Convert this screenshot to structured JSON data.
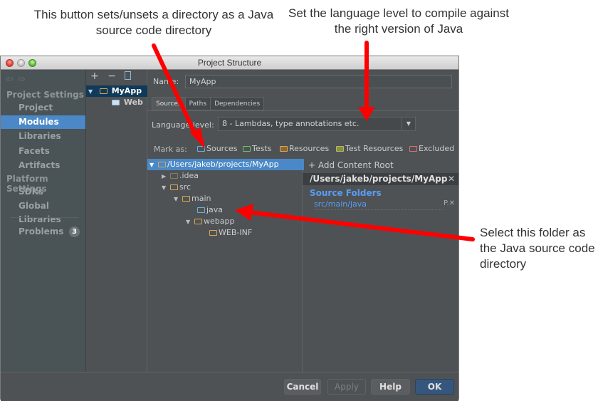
{
  "annotations": {
    "top_left": "This button sets/unsets a directory as a Java source code directory",
    "top_right": "Set the language level to compile against the right version of Java",
    "right": "Select this folder as the Java source code directory"
  },
  "window": {
    "title": "Project Structure"
  },
  "sidebar": {
    "nav_back": "⇦",
    "nav_forward": "⇨",
    "sections": [
      {
        "heading": "Project Settings",
        "items": [
          "Project",
          "Modules",
          "Libraries",
          "Facets",
          "Artifacts"
        ]
      },
      {
        "heading": "Platform Settings",
        "items": [
          "SDKs",
          "Global Libraries"
        ]
      }
    ],
    "selected": "Modules",
    "problems": {
      "label": "Problems",
      "count": "3"
    }
  },
  "modules": {
    "toolbar": {
      "add": "+",
      "remove": "−",
      "copy": "copy"
    },
    "items": [
      {
        "label": "MyApp",
        "expanded": true,
        "selected": true
      },
      {
        "label": "Web",
        "selected": false
      }
    ]
  },
  "main": {
    "name_label": "Name:",
    "name_value": "MyApp",
    "tabs": [
      "Sources",
      "Paths",
      "Dependencies"
    ],
    "active_tab": "Sources",
    "language_level_label": "Language level:",
    "language_level_value": "8 - Lambdas, type annotations etc.",
    "mark_as_label": "Mark as:",
    "mark_as_buttons": [
      {
        "label": "Sources",
        "color": "#6fb0e0"
      },
      {
        "label": "Tests",
        "color": "#6ec06e"
      },
      {
        "label": "Resources",
        "color": "#d9a75b"
      },
      {
        "label": "Test Resources",
        "color": "#d9a75b"
      },
      {
        "label": "Excluded",
        "color": "#e07070"
      }
    ],
    "tree": [
      {
        "label": "/Users/jakeb/projects/MyApp",
        "depth": 0,
        "toggle": "▼",
        "selected": true
      },
      {
        "label": ".idea",
        "depth": 1,
        "toggle": "▶"
      },
      {
        "label": "src",
        "depth": 1,
        "toggle": "▼"
      },
      {
        "label": "main",
        "depth": 2,
        "toggle": "▼"
      },
      {
        "label": "java",
        "depth": 3,
        "toggle": "",
        "source": true
      },
      {
        "label": "webapp",
        "depth": 3,
        "toggle": "▼"
      },
      {
        "label": "WEB-INF",
        "depth": 4,
        "toggle": ""
      }
    ],
    "content_root": {
      "add_label": "+ Add Content Root",
      "path": "/Users/jakeb/projects/MyApp",
      "source_folders_title": "Source Folders",
      "source_folders": [
        "src/main/java"
      ],
      "source_actions": "P.✕"
    }
  },
  "footer": {
    "cancel": "Cancel",
    "apply": "Apply",
    "help": "Help",
    "ok": "OK"
  },
  "colors": {
    "selection": "#4a88c7",
    "source_blue": "#589df6",
    "arrow_red": "#ff0000"
  }
}
